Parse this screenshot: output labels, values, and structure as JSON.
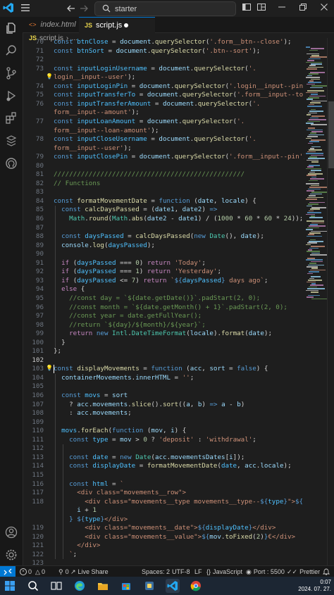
{
  "titlebar": {
    "search_text": "starter"
  },
  "tabs": [
    {
      "label": "index.html",
      "badge": "<>"
    },
    {
      "label": "script.js",
      "badge": "JS"
    }
  ],
  "breadcrumb": {
    "badge": "JS",
    "file": "script.js",
    "more": "..."
  },
  "activity_icons": [
    "explorer-icon",
    "search-icon",
    "source-control-icon",
    "run-debug-icon",
    "extensions-icon",
    "remote-explorer-icon",
    "github-icon",
    "account-icon",
    "settings-gear-icon"
  ],
  "code_lines": [
    {
      "n": "70",
      "html": "<span class='k'>const</span> <span class='cn'>btnClose</span> = <span class='v'>document</span>.<span class='f'>querySelector</span>(<span class='s'>'.form__btn--close'</span>);"
    },
    {
      "n": "71",
      "html": "<span class='k'>const</span> <span class='cn'>btnSort</span> = <span class='v'>document</span>.<span class='f'>querySelector</span>(<span class='s'>'.btn--sort'</span>);"
    },
    {
      "n": "72",
      "html": ""
    },
    {
      "n": "73",
      "html": "<span class='k'>const</span> <span class='cn'>inputLoginUsername</span> = <span class='v'>document</span>.<span class='f'>querySelector</span>(<span class='s'>'.</span>"
    },
    {
      "n": "",
      "html": "<span class='s'>login__input--user'</span>);"
    },
    {
      "n": "74",
      "html": "<span class='k'>const</span> <span class='cn'>inputLoginPin</span> = <span class='v'>document</span>.<span class='f'>querySelector</span>(<span class='s'>'.login__input--pin'</span>);"
    },
    {
      "n": "75",
      "html": "<span class='k'>const</span> <span class='cn'>inputTransferTo</span> = <span class='v'>document</span>.<span class='f'>querySelector</span>(<span class='s'>'.form__input--to'</span>);"
    },
    {
      "n": "76",
      "html": "<span class='k'>const</span> <span class='cn'>inputTransferAmount</span> = <span class='v'>document</span>.<span class='f'>querySelector</span>(<span class='s'>'.</span>"
    },
    {
      "n": "",
      "html": "<span class='s'>form__input--amount'</span>);"
    },
    {
      "n": "77",
      "html": "<span class='k'>const</span> <span class='cn'>inputLoanAmount</span> = <span class='v'>document</span>.<span class='f'>querySelector</span>(<span class='s'>'.</span>"
    },
    {
      "n": "",
      "html": "<span class='s'>form__input--loan-amount'</span>);"
    },
    {
      "n": "78",
      "html": "<span class='k'>const</span> <span class='cn'>inputCloseUsername</span> = <span class='v'>document</span>.<span class='f'>querySelector</span>(<span class='s'>'.</span>"
    },
    {
      "n": "",
      "html": "<span class='s'>form__input--user'</span>);"
    },
    {
      "n": "79",
      "html": "<span class='k'>const</span> <span class='cn'>inputClosePin</span> = <span class='v'>document</span>.<span class='f'>querySelector</span>(<span class='s'>'.form__input--pin'</span>);"
    },
    {
      "n": "80",
      "html": ""
    },
    {
      "n": "81",
      "html": "<span class='cm'>/////////////////////////////////////////////////</span>"
    },
    {
      "n": "82",
      "html": "<span class='cm'>// Functions</span>"
    },
    {
      "n": "83",
      "html": ""
    },
    {
      "n": "84",
      "html": "<span class='k'>const</span> <span class='f'>formatMovementDate</span> = <span class='k'>function</span> (<span class='v'>date</span>, <span class='v'>locale</span>) {"
    },
    {
      "n": "85",
      "html": "  <span class='k'>const</span> <span class='f'>calcDaysPassed</span> = (<span class='v'>date1</span>, <span class='v'>date2</span>) <span class='k'>=&gt;</span>"
    },
    {
      "n": "86",
      "html": "    <span class='t'>Math</span>.<span class='f'>round</span>(<span class='t'>Math</span>.<span class='f'>abs</span>(<span class='v'>date2</span> - <span class='v'>date1</span>) / (<span class='n'>1000</span> * <span class='n'>60</span> * <span class='n'>60</span> * <span class='n'>24</span>));"
    },
    {
      "n": "87",
      "html": ""
    },
    {
      "n": "88",
      "html": "  <span class='k'>const</span> <span class='cn'>daysPassed</span> = <span class='f'>calcDaysPassed</span>(<span class='k'>new</span> <span class='t'>Date</span>(), <span class='v'>date</span>);"
    },
    {
      "n": "89",
      "html": "  <span class='v'>console</span>.<span class='f'>log</span>(<span class='cn'>daysPassed</span>);"
    },
    {
      "n": "90",
      "html": ""
    },
    {
      "n": "91",
      "html": "  <span class='c'>if</span> (<span class='cn'>daysPassed</span> === <span class='n'>0</span>) <span class='c'>return</span> <span class='s'>'Today'</span>;"
    },
    {
      "n": "92",
      "html": "  <span class='c'>if</span> (<span class='cn'>daysPassed</span> === <span class='n'>1</span>) <span class='c'>return</span> <span class='s'>'Yesterday'</span>;"
    },
    {
      "n": "93",
      "html": "  <span class='c'>if</span> (<span class='cn'>daysPassed</span> &lt;= <span class='n'>7</span>) <span class='c'>return</span> <span class='s'>`</span><span class='k'>${</span><span class='cn'>daysPassed</span><span class='k'>}</span><span class='s'> days ago`</span>;"
    },
    {
      "n": "94",
      "html": "  <span class='c'>else</span> {"
    },
    {
      "n": "95",
      "html": "    <span class='cm'>//const day = `${date.getDate()}`.padStart(2, 0);</span>"
    },
    {
      "n": "96",
      "html": "    <span class='cm'>//const month = `${date.getMonth() + 1}`.padStart(2, 0);</span>"
    },
    {
      "n": "97",
      "html": "    <span class='cm'>//const year = date.getFullYear();</span>"
    },
    {
      "n": "98",
      "html": "    <span class='cm'>//return `${day}/${month}/${year}`;</span>"
    },
    {
      "n": "99",
      "html": "    <span class='c'>return</span> <span class='k'>new</span> <span class='t'>Intl</span>.<span class='t'>DateTimeFormat</span>(<span class='v'>locale</span>).<span class='f'>format</span>(<span class='v'>date</span>);"
    },
    {
      "n": "100",
      "html": "  }"
    },
    {
      "n": "101",
      "html": "};"
    },
    {
      "n": "102",
      "html": ""
    },
    {
      "n": "103",
      "html": "<span class='k'>const</span> <span class='f'>displayMovements</span> = <span class='k'>function</span> (<span class='v'>acc</span>, <span class='v'>sort</span> = <span class='k'>false</span>) {"
    },
    {
      "n": "104",
      "html": "  <span class='v'>containerMovements</span>.<span class='v'>innerHTML</span> = <span class='s'>''</span>;"
    },
    {
      "n": "105",
      "html": ""
    },
    {
      "n": "106",
      "html": "  <span class='k'>const</span> <span class='cn'>movs</span> = <span class='v'>sort</span>"
    },
    {
      "n": "107",
      "html": "    ? <span class='v'>acc</span>.<span class='v'>movements</span>.<span class='f'>slice</span>().<span class='f'>sort</span>((<span class='v'>a</span>, <span class='v'>b</span>) <span class='k'>=&gt;</span> <span class='v'>a</span> - <span class='v'>b</span>)"
    },
    {
      "n": "108",
      "html": "    : <span class='v'>acc</span>.<span class='v'>movements</span>;"
    },
    {
      "n": "109",
      "html": ""
    },
    {
      "n": "110",
      "html": "  <span class='cn'>movs</span>.<span class='f'>forEach</span>(<span class='k'>function</span> (<span class='v'>mov</span>, <span class='v'>i</span>) {"
    },
    {
      "n": "111",
      "html": "    <span class='k'>const</span> <span class='cn'>type</span> = <span class='v'>mov</span> &gt; <span class='n'>0</span> ? <span class='s'>'deposit'</span> : <span class='s'>'withdrawal'</span>;"
    },
    {
      "n": "112",
      "html": ""
    },
    {
      "n": "113",
      "html": "    <span class='k'>const</span> <span class='cn'>date</span> = <span class='k'>new</span> <span class='t'>Date</span>(<span class='v'>acc</span>.<span class='v'>movementsDates</span>[<span class='v'>i</span>]);"
    },
    {
      "n": "114",
      "html": "    <span class='k'>const</span> <span class='cn'>displayDate</span> = <span class='f'>formatMovementDate</span>(<span class='cn'>date</span>, <span class='v'>acc</span>.<span class='v'>locale</span>);"
    },
    {
      "n": "115",
      "html": ""
    },
    {
      "n": "116",
      "html": "    <span class='k'>const</span> <span class='cn'>html</span> = <span class='s'>`</span>"
    },
    {
      "n": "117",
      "html": "<span class='s'>      &lt;div class=\"movements__row\"&gt;</span>"
    },
    {
      "n": "118",
      "html": "<span class='s'>        &lt;div class=\"movements__type movements__type--</span><span class='k'>${</span><span class='cn'>type</span><span class='k'>}</span><span class='s'>\"&gt;</span><span class='k'>${</span>"
    },
    {
      "n": "",
      "html": "      <span class='v'>i</span> + <span class='n'>1</span>"
    },
    {
      "n": "",
      "html": "    <span class='k'>}</span> <span class='k'>${</span><span class='cn'>type</span><span class='k'>}</span><span class='s'>&lt;/div&gt;</span>"
    },
    {
      "n": "119",
      "html": "<span class='s'>        &lt;div class=\"movements__date\"&gt;</span><span class='k'>${</span><span class='cn'>displayDate</span><span class='k'>}</span><span class='s'>&lt;/div&gt;</span>"
    },
    {
      "n": "120",
      "html": "<span class='s'>        &lt;div class=\"movements__value\"&gt;</span><span class='k'>${</span><span class='v'>mov</span>.<span class='f'>toFixed</span>(<span class='n'>2</span>)<span class='k'>}</span><span class='s'>€&lt;/div&gt;</span>"
    },
    {
      "n": "121",
      "html": "<span class='s'>      &lt;/div&gt;</span>"
    },
    {
      "n": "122",
      "html": "<span class='s'>    `</span>;"
    },
    {
      "n": "123",
      "html": ""
    }
  ],
  "statusbar": {
    "errors": "0",
    "warnings": "0",
    "info": "0",
    "live_share": "Live Share",
    "spaces": "Spaces: 2",
    "encoding": "UTF-8",
    "eol": "LF",
    "language": "JavaScript",
    "port": "Port : 5500",
    "prettier": "Prettier"
  },
  "taskbar": {
    "time": "0:07",
    "date": "2024. 07. 27."
  }
}
